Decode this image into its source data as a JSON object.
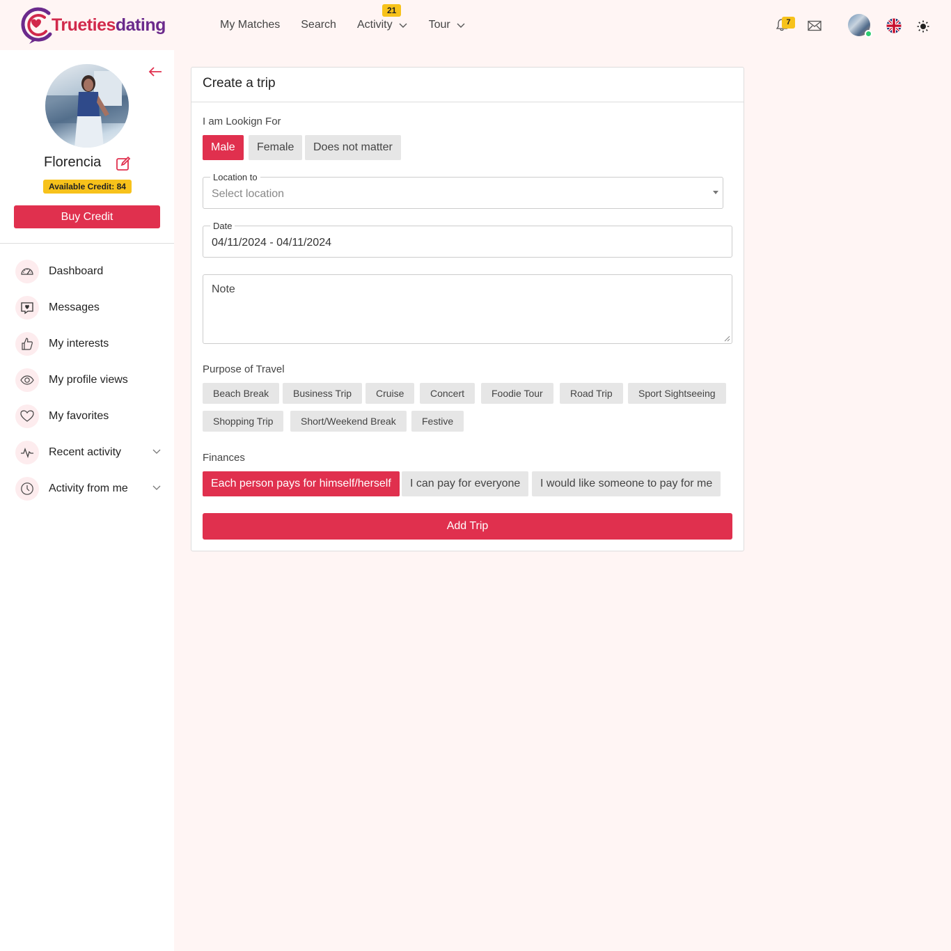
{
  "brand": {
    "name_part1": "Trueties",
    "name_part2": "dating",
    "accent": "#e0304e",
    "badge_color": "#f7c21b"
  },
  "nav": {
    "items": [
      {
        "label": "My Matches"
      },
      {
        "label": "Search"
      },
      {
        "label": "Activity",
        "badge": "21",
        "dropdown": true
      },
      {
        "label": "Tour",
        "dropdown": true
      }
    ]
  },
  "header_icons": {
    "notifications_count": "7",
    "icons": [
      "bell-icon",
      "mail-icon",
      "avatar",
      "uk-flag-icon",
      "sun-icon"
    ]
  },
  "sidebar": {
    "name": "Florencia",
    "credit": "Available Credit: 84",
    "buy_label": "Buy Credit",
    "menu": [
      {
        "label": "Dashboard",
        "icon": "speedometer-icon"
      },
      {
        "label": "Messages",
        "icon": "heart-chat-icon"
      },
      {
        "label": "My interests",
        "icon": "thumbs-up-icon"
      },
      {
        "label": "My profile views",
        "icon": "eye-icon"
      },
      {
        "label": "My favorites",
        "icon": "heart-icon"
      },
      {
        "label": "Recent activity",
        "icon": "pulse-icon",
        "dropdown": true
      },
      {
        "label": "Activity from me",
        "icon": "clock-icon",
        "dropdown": true
      }
    ]
  },
  "form": {
    "title": "Create a trip",
    "looking_for_label": "I am Lookign For",
    "looking_for_options": [
      "Male",
      "Female",
      "Does not matter"
    ],
    "looking_for_selected": "Male",
    "location_label": "Location to",
    "location_placeholder": "Select location",
    "date_label": "Date",
    "date_value": "04/11/2024 - 04/11/2024",
    "note_placeholder": "Note",
    "purpose_label": "Purpose of Travel",
    "purposes": [
      "Beach Break",
      "Business Trip",
      "Cruise",
      "Concert",
      "Foodie Tour",
      "Road Trip",
      "Sport Sightseeing",
      "Shopping Trip",
      "Short/Weekend Break",
      "Festive"
    ],
    "finances_label": "Finances",
    "finances_options": [
      "Each person pays for himself/herself",
      "I can pay for everyone",
      "I would like someone to pay for me"
    ],
    "finances_selected": "Each person pays for himself/herself",
    "submit_label": "Add Trip"
  }
}
